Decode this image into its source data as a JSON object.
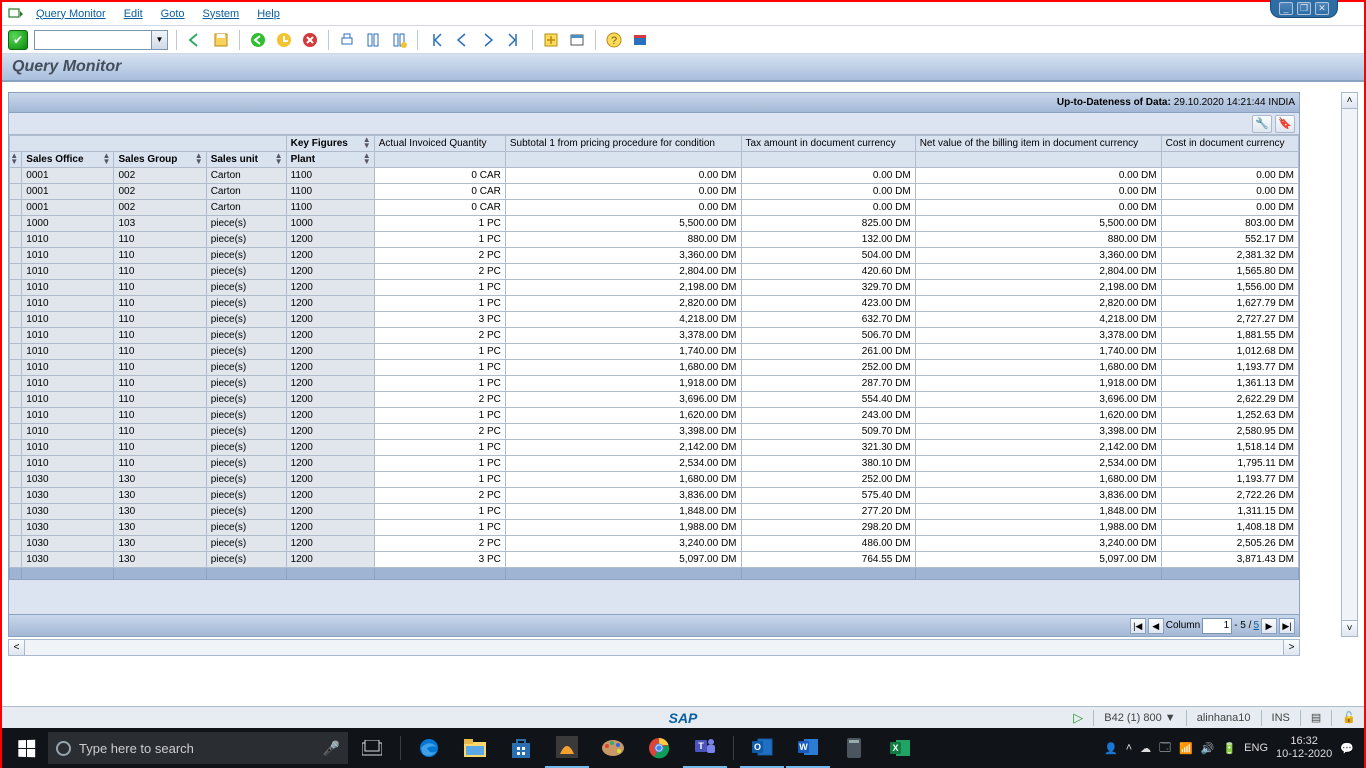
{
  "menubar": {
    "items": [
      "Query Monitor",
      "Edit",
      "Goto",
      "System",
      "Help"
    ]
  },
  "window_controls": [
    "_",
    "❐",
    "✕"
  ],
  "title": "Query Monitor",
  "panel_header": {
    "label": "Up-to-Dateness of Data:",
    "value": "29.10.2020 14:21:44 INDIA"
  },
  "columns": {
    "dim": [
      "Sales Office",
      "Sales Group",
      "Sales unit",
      "Plant"
    ],
    "kf_label": "Key Figures",
    "kf": [
      "Actual Invoiced Quantity",
      "Subtotal 1 from pricing procedure for condition",
      "Tax amount in document currency",
      "Net value of the billing item in document currency",
      "Cost in document currency"
    ]
  },
  "rows": [
    [
      "0001",
      "002",
      "Carton",
      "1100",
      "0 CAR",
      "0.00 DM",
      "0.00 DM",
      "0.00 DM",
      "0.00 DM"
    ],
    [
      "0001",
      "002",
      "Carton",
      "1100",
      "0 CAR",
      "0.00 DM",
      "0.00 DM",
      "0.00 DM",
      "0.00 DM"
    ],
    [
      "0001",
      "002",
      "Carton",
      "1100",
      "0 CAR",
      "0.00 DM",
      "0.00 DM",
      "0.00 DM",
      "0.00 DM"
    ],
    [
      "1000",
      "103",
      "piece(s)",
      "1000",
      "1 PC",
      "5,500.00 DM",
      "825.00 DM",
      "5,500.00 DM",
      "803.00 DM"
    ],
    [
      "1010",
      "110",
      "piece(s)",
      "1200",
      "1 PC",
      "880.00 DM",
      "132.00 DM",
      "880.00 DM",
      "552.17 DM"
    ],
    [
      "1010",
      "110",
      "piece(s)",
      "1200",
      "2 PC",
      "3,360.00 DM",
      "504.00 DM",
      "3,360.00 DM",
      "2,381.32 DM"
    ],
    [
      "1010",
      "110",
      "piece(s)",
      "1200",
      "2 PC",
      "2,804.00 DM",
      "420.60 DM",
      "2,804.00 DM",
      "1,565.80 DM"
    ],
    [
      "1010",
      "110",
      "piece(s)",
      "1200",
      "1 PC",
      "2,198.00 DM",
      "329.70 DM",
      "2,198.00 DM",
      "1,556.00 DM"
    ],
    [
      "1010",
      "110",
      "piece(s)",
      "1200",
      "1 PC",
      "2,820.00 DM",
      "423.00 DM",
      "2,820.00 DM",
      "1,627.79 DM"
    ],
    [
      "1010",
      "110",
      "piece(s)",
      "1200",
      "3 PC",
      "4,218.00 DM",
      "632.70 DM",
      "4,218.00 DM",
      "2,727.27 DM"
    ],
    [
      "1010",
      "110",
      "piece(s)",
      "1200",
      "2 PC",
      "3,378.00 DM",
      "506.70 DM",
      "3,378.00 DM",
      "1,881.55 DM"
    ],
    [
      "1010",
      "110",
      "piece(s)",
      "1200",
      "1 PC",
      "1,740.00 DM",
      "261.00 DM",
      "1,740.00 DM",
      "1,012.68 DM"
    ],
    [
      "1010",
      "110",
      "piece(s)",
      "1200",
      "1 PC",
      "1,680.00 DM",
      "252.00 DM",
      "1,680.00 DM",
      "1,193.77 DM"
    ],
    [
      "1010",
      "110",
      "piece(s)",
      "1200",
      "1 PC",
      "1,918.00 DM",
      "287.70 DM",
      "1,918.00 DM",
      "1,361.13 DM"
    ],
    [
      "1010",
      "110",
      "piece(s)",
      "1200",
      "2 PC",
      "3,696.00 DM",
      "554.40 DM",
      "3,696.00 DM",
      "2,622.29 DM"
    ],
    [
      "1010",
      "110",
      "piece(s)",
      "1200",
      "1 PC",
      "1,620.00 DM",
      "243.00 DM",
      "1,620.00 DM",
      "1,252.63 DM"
    ],
    [
      "1010",
      "110",
      "piece(s)",
      "1200",
      "2 PC",
      "3,398.00 DM",
      "509.70 DM",
      "3,398.00 DM",
      "2,580.95 DM"
    ],
    [
      "1010",
      "110",
      "piece(s)",
      "1200",
      "1 PC",
      "2,142.00 DM",
      "321.30 DM",
      "2,142.00 DM",
      "1,518.14 DM"
    ],
    [
      "1010",
      "110",
      "piece(s)",
      "1200",
      "1 PC",
      "2,534.00 DM",
      "380.10 DM",
      "2,534.00 DM",
      "1,795.11 DM"
    ],
    [
      "1030",
      "130",
      "piece(s)",
      "1200",
      "1 PC",
      "1,680.00 DM",
      "252.00 DM",
      "1,680.00 DM",
      "1,193.77 DM"
    ],
    [
      "1030",
      "130",
      "piece(s)",
      "1200",
      "2 PC",
      "3,836.00 DM",
      "575.40 DM",
      "3,836.00 DM",
      "2,722.26 DM"
    ],
    [
      "1030",
      "130",
      "piece(s)",
      "1200",
      "1 PC",
      "1,848.00 DM",
      "277.20 DM",
      "1,848.00 DM",
      "1,311.15 DM"
    ],
    [
      "1030",
      "130",
      "piece(s)",
      "1200",
      "1 PC",
      "1,988.00 DM",
      "298.20 DM",
      "1,988.00 DM",
      "1,408.18 DM"
    ],
    [
      "1030",
      "130",
      "piece(s)",
      "1200",
      "2 PC",
      "3,240.00 DM",
      "486.00 DM",
      "3,240.00 DM",
      "2,505.26 DM"
    ],
    [
      "1030",
      "130",
      "piece(s)",
      "1200",
      "3 PC",
      "5,097.00 DM",
      "764.55 DM",
      "5,097.00 DM",
      "3,871.43 DM"
    ]
  ],
  "pager": {
    "label": "Column",
    "value": "1",
    "range_sep": " - 5 / ",
    "total": "5"
  },
  "statusbar": {
    "sap_logo": "SAP",
    "play": "▷",
    "system": "B42 (1) 800 ▼",
    "user": "alinhana10",
    "mode": "INS"
  },
  "taskbar": {
    "search_placeholder": "Type here to search",
    "tray": {
      "lang": "ENG",
      "time": "16:32",
      "date": "10-12-2020"
    }
  }
}
